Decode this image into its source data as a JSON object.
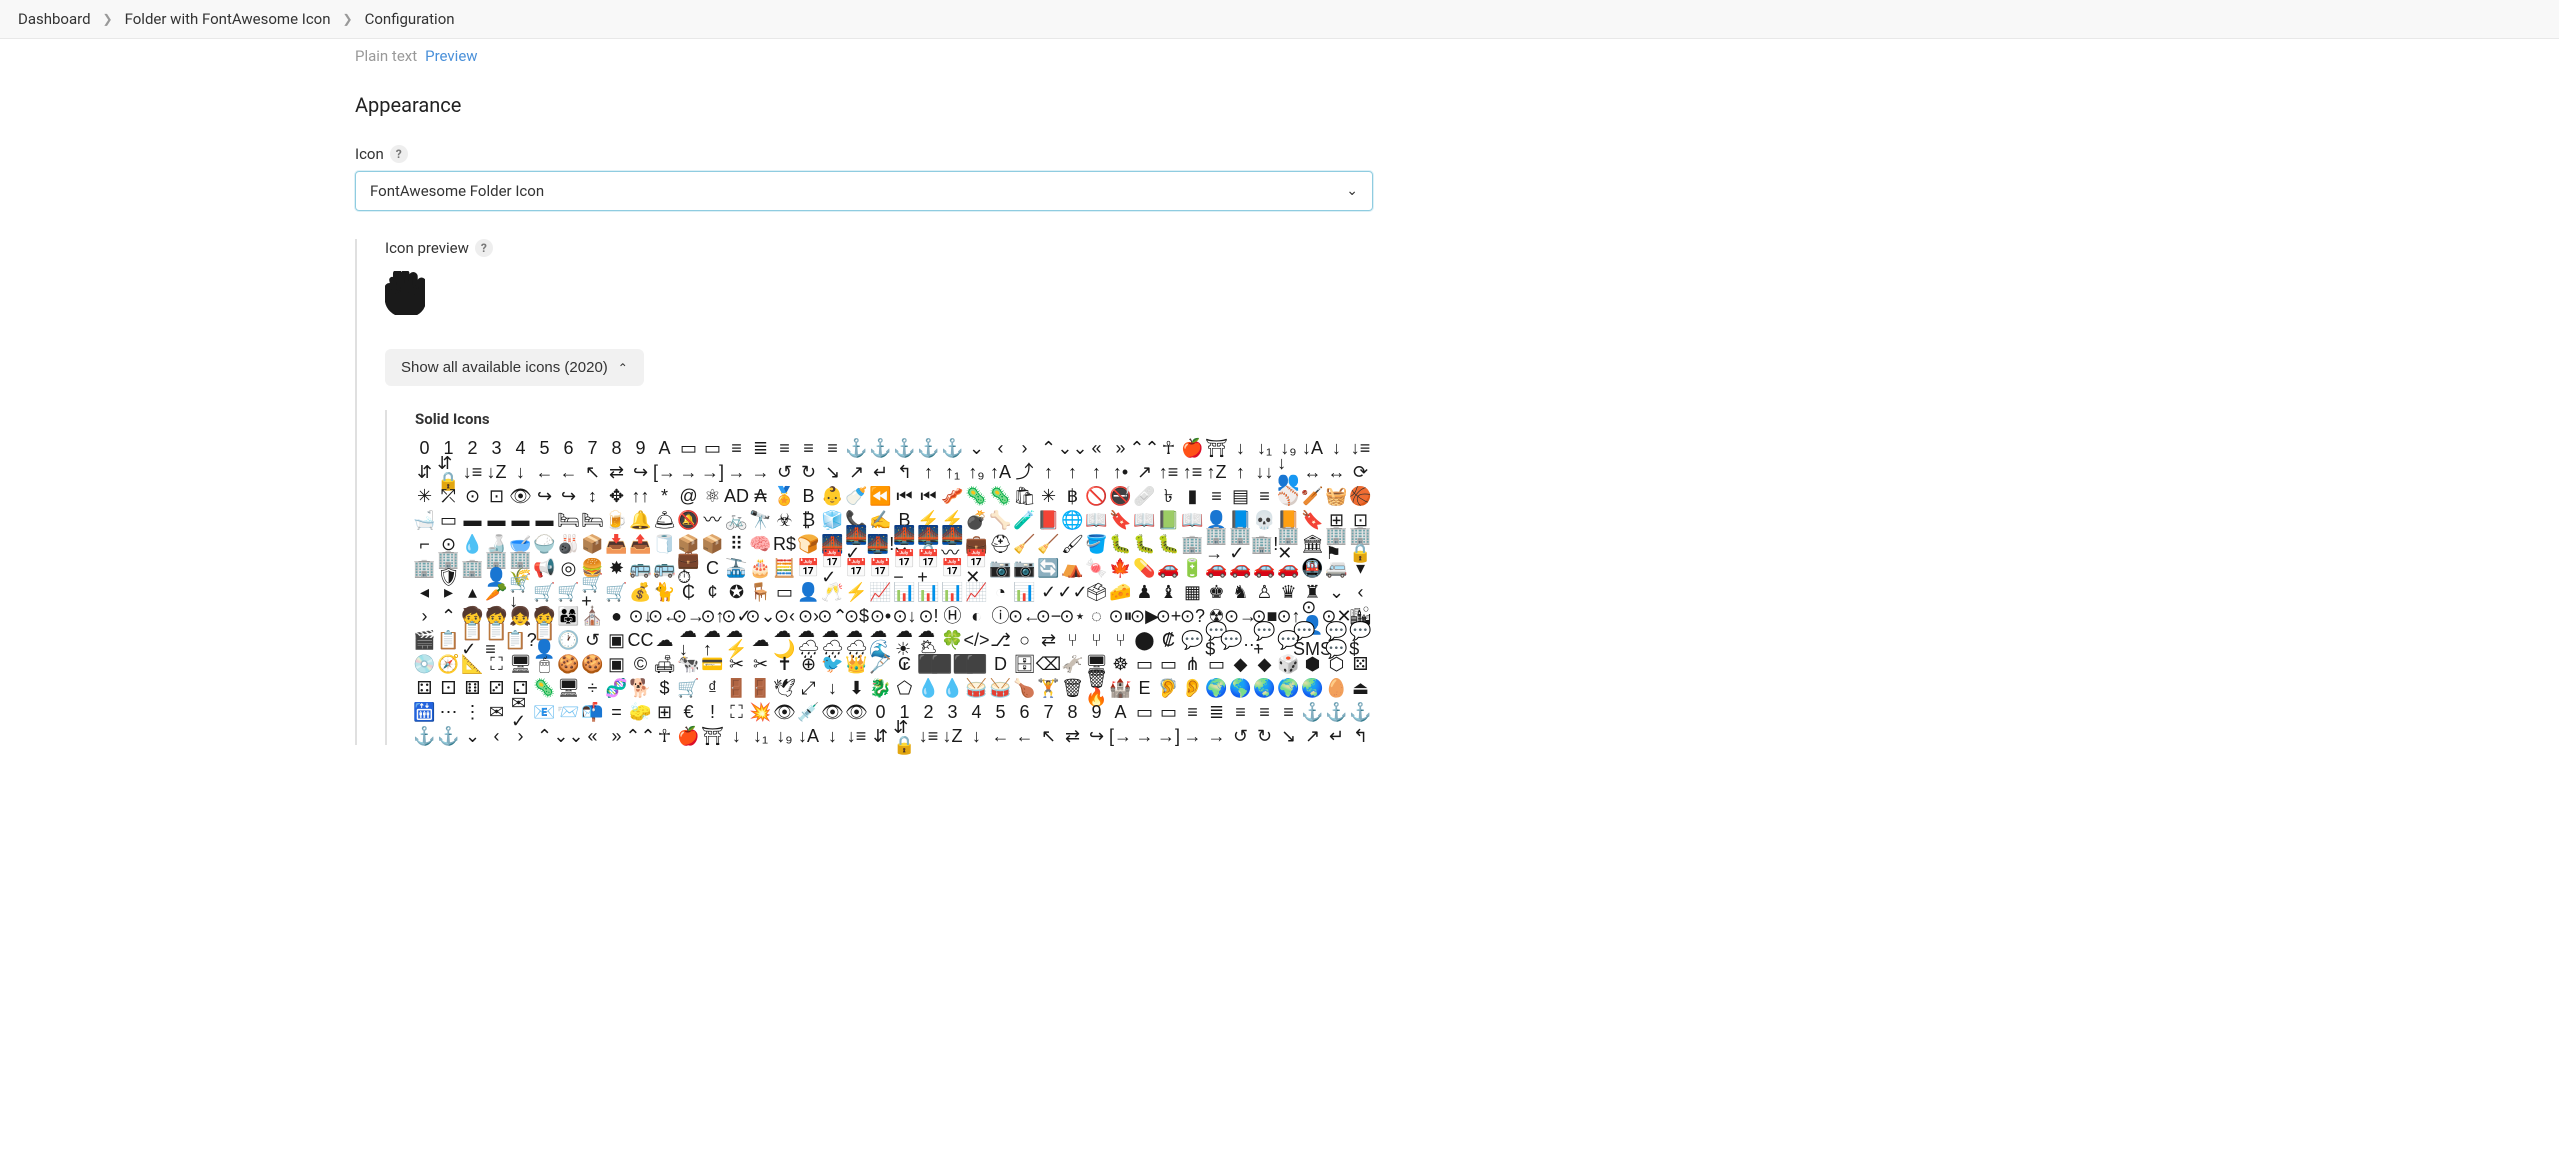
{
  "breadcrumb": {
    "items": [
      "Dashboard",
      "Folder with FontAwesome Icon",
      "Configuration"
    ]
  },
  "tabs": {
    "plain_text": "Plain text",
    "preview": "Preview"
  },
  "section": {
    "appearance_heading": "Appearance",
    "icon_label": "Icon",
    "help_glyph": "?",
    "icon_select_value": "FontAwesome Folder Icon",
    "icon_preview_label": "Icon preview",
    "expand_label": "Show all available icons (2020)",
    "solid_icons_heading": "Solid Icons"
  },
  "icon_grid": {
    "category": "Solid Icons",
    "total_shown_approx": 520,
    "sample_names": [
      "0",
      "1",
      "2",
      "3",
      "4",
      "5",
      "6",
      "7",
      "8",
      "9",
      "A",
      "address-card",
      "address-book",
      "align-center",
      "align-justify",
      "align-left",
      "align-right",
      "anchor",
      "anchor-circle-check",
      "anchor-circle-exclamation",
      "anchor-circle-xmark",
      "anchor-lock",
      "angle-down",
      "angle-left",
      "angle-right",
      "angle-up",
      "angles-down",
      "angles-left",
      "angles-right",
      "angles-up",
      "ankh",
      "apple-whole",
      "archway",
      "arrow-down",
      "arrow-down-1-9",
      "arrow-down-9-1",
      "arrow-down-a-z",
      "arrow-down-long",
      "arrow-down-short-wide",
      "arrow-down-up-across-line",
      "arrow-down-up-lock",
      "arrow-down-wide-short",
      "arrow-down-z-a",
      "arrow-left",
      "arrow-left-long",
      "arrow-pointer",
      "arrow-right",
      "arrow-right-arrow-left",
      "arrow-right-from-bracket",
      "arrow-right-long",
      "arrow-right-to-bracket",
      "arrow-right-to-city",
      "arrow-rotate-left",
      "arrow-rotate-right",
      "arrow-trend-down",
      "arrow-trend-up",
      "arrow-turn-down",
      "arrow-turn-up",
      "arrow-up",
      "arrow-up-1-9",
      "arrow-up-9-1",
      "arrow-up-a-z",
      "arrow-up-from-bracket",
      "arrow-up-from-ground-water",
      "arrow-up-from-water-pump",
      "arrow-up-long",
      "arrow-up-right-dots",
      "arrow-up-right-from-square",
      "arrow-up-short-wide",
      "arrow-up-wide-short",
      "arrow-up-z-a",
      "arrows-down-to-line",
      "arrows-down-to-people",
      "arrows-left-right",
      "arrows-left-right-to-line",
      "arrows-rotate",
      "arrows-spin",
      "arrows-split-up-and-left",
      "arrows-to-circle",
      "arrows-to-dot",
      "arrows-to-eye",
      "arrows-turn-right",
      "arrows-turn-to-dots",
      "arrows-up-down",
      "arrows-up-down-left-right",
      "arrows-up-to-line",
      "asterisk",
      "at",
      "atom",
      "audio-description",
      "austral-sign",
      "award",
      "b",
      "baby",
      "baby-carriage",
      "backward",
      "backward-fast",
      "backward-step",
      "bacon",
      "bacteria",
      "bacterium",
      "bag-shopping",
      "bahai",
      "baht-sign",
      "ban",
      "ban-smoking",
      "bandage",
      "bangladeshi-taka-sign",
      "barcode",
      "bars",
      "bars-progress",
      "bars-staggered",
      "baseball",
      "baseball-bat-ball",
      "basket-shopping",
      "basketball",
      "bath",
      "battery-empty",
      "battery-full",
      "battery-half",
      "battery-quarter",
      "battery-three-quarters",
      "bed",
      "bed-pulse",
      "beer-mug-empty",
      "bell",
      "bell-concierge",
      "bell-slash",
      "bezier-curve",
      "bicycle",
      "binoculars",
      "biohazard",
      "bitcoin-sign",
      "blender",
      "blender-phone",
      "blog",
      "bold",
      "bolt",
      "bolt-lightning",
      "bomb",
      "bone",
      "bong",
      "book",
      "book-atlas",
      "book-bible",
      "book-bookmark",
      "book-journal-whills",
      "book-medical",
      "book-open",
      "book-open-reader",
      "book-quran",
      "book-skull",
      "book-tanakh",
      "bookmark",
      "border-all",
      "border-none",
      "border-top-left",
      "bore-hole",
      "bottle-droplet",
      "bottle-water",
      "bowl-food",
      "bowl-rice",
      "bowling-ball",
      "box",
      "box-archive",
      "box-open",
      "box-tissue",
      "boxes-packing",
      "boxes-stacked",
      "braille",
      "brain",
      "brazilian-real-sign",
      "bread-slice",
      "bridge",
      "bridge-circle-check",
      "bridge-circle-exclamation",
      "bridge-circle-xmark",
      "bridge-lock",
      "bridge-water",
      "briefcase",
      "briefcase-medical",
      "broom",
      "broom-ball",
      "brush",
      "bucket",
      "bug",
      "bug-slash",
      "bugs",
      "building",
      "building-circle-arrow-right",
      "building-circle-check",
      "building-circle-exclamation",
      "building-circle-xmark",
      "building-columns",
      "building-flag",
      "building-lock",
      "building-ngo",
      "building-shield",
      "building-un",
      "building-user",
      "building-wheat",
      "bullhorn",
      "bullseye",
      "burger",
      "burst",
      "bus",
      "bus-simple",
      "business-time",
      "c",
      "cable-car",
      "cake-candles",
      "calculator",
      "calendar",
      "calendar-check",
      "calendar-day",
      "calendar-days",
      "calendar-minus",
      "calendar-plus",
      "calendar-week",
      "calendar-xmark",
      "camera",
      "camera-retro",
      "camera-rotate",
      "campground",
      "candy-cane",
      "cannabis",
      "capsules",
      "car",
      "car-battery",
      "car-burst",
      "car-on",
      "car-rear",
      "car-side",
      "car-tunnel",
      "caravan",
      "caret-down",
      "caret-left",
      "caret-right",
      "caret-up",
      "carrot",
      "cart-arrow-down",
      "cart-flatbed",
      "cart-flatbed-suitcase",
      "cart-plus",
      "cart-shopping",
      "cash-register",
      "cat",
      "cedi-sign",
      "cent-sign",
      "certificate",
      "chair",
      "chalkboard",
      "chalkboard-user",
      "champagne-glasses",
      "charging-station",
      "chart-area",
      "chart-bar",
      "chart-column",
      "chart-gantt",
      "chart-line",
      "chart-pie",
      "chart-simple",
      "check",
      "check-double",
      "check-to-slot",
      "cheese",
      "chess",
      "chess-bishop",
      "chess-board",
      "chess-king",
      "chess-knight",
      "chess-pawn",
      "chess-queen",
      "chess-rook",
      "chevron-down",
      "chevron-left",
      "chevron-right",
      "chevron-up",
      "child",
      "child-combatant",
      "child-dress",
      "child-reaching",
      "children",
      "church",
      "circle",
      "circle-arrow-down",
      "circle-arrow-left",
      "circle-arrow-right",
      "circle-arrow-up",
      "circle-check",
      "circle-chevron-down",
      "circle-chevron-left",
      "circle-chevron-right",
      "circle-chevron-up",
      "circle-dollar-to-slot",
      "circle-dot",
      "circle-down",
      "circle-exclamation",
      "circle-h",
      "circle-half-stroke",
      "circle-info",
      "circle-left",
      "circle-minus",
      "circle-nodes",
      "circle-notch",
      "circle-pause",
      "circle-play",
      "circle-plus",
      "circle-question",
      "circle-radiation",
      "circle-right",
      "circle-stop",
      "circle-up",
      "circle-user",
      "circle-xmark",
      "city",
      "clapperboard",
      "clipboard",
      "clipboard-check",
      "clipboard-list",
      "clipboard-question",
      "clipboard-user",
      "clock",
      "clock-rotate-left",
      "clone",
      "closed-captioning",
      "cloud",
      "cloud-arrow-down",
      "cloud-arrow-up",
      "cloud-bolt",
      "cloud-meatball",
      "cloud-moon",
      "cloud-moon-rain",
      "cloud-rain",
      "cloud-showers-heavy",
      "cloud-showers-water",
      "cloud-sun",
      "cloud-sun-rain",
      "clover",
      "code",
      "code-branch",
      "code-commit",
      "code-compare",
      "code-fork",
      "code-merge",
      "code-pull-request",
      "coins",
      "colon-sign",
      "comment",
      "comment-dollar",
      "comment-dots",
      "comment-medical",
      "comment-slash",
      "comment-sms",
      "comments",
      "comments-dollar",
      "compact-disc",
      "compass",
      "compass-drafting",
      "compress",
      "computer",
      "computer-mouse",
      "cookie",
      "cookie-bite",
      "copy",
      "copyright",
      "couch",
      "cow",
      "credit-card",
      "crop",
      "crop-simple",
      "cross",
      "crosshairs",
      "crow",
      "crown",
      "crutch",
      "cruzeiro-sign",
      "cube",
      "cubes",
      "cubes-stacked",
      "d",
      "database",
      "delete-left",
      "democrat",
      "desktop",
      "dharmachakra",
      "diagram-next",
      "diagram-predecessor",
      "diagram-project",
      "diagram-successor",
      "diamond",
      "diamond-turn-right",
      "dice",
      "dice-d20",
      "dice-d6",
      "dice-five",
      "dice-four",
      "dice-one",
      "dice-six",
      "dice-three",
      "dice-two",
      "disease",
      "display",
      "divide",
      "dna",
      "dog",
      "dollar-sign",
      "dolly",
      "dong-sign",
      "door-closed",
      "door-open",
      "dove",
      "down-left-and-up-right-to-center",
      "down-long",
      "download",
      "dragon",
      "draw-polygon",
      "droplet",
      "droplet-slash",
      "drum",
      "drum-steelpan",
      "drumstick-bite",
      "dumbbell",
      "dumpster",
      "dumpster-fire",
      "dungeon",
      "e",
      "ear-deaf",
      "ear-listen",
      "earth-africa",
      "earth-americas",
      "earth-asia",
      "earth-europe",
      "earth-oceania",
      "egg",
      "eject",
      "elevator",
      "ellipsis",
      "ellipsis-vertical",
      "envelope",
      "envelope-circle-check",
      "envelope-open",
      "envelope-open-text",
      "envelopes-bulk",
      "equals",
      "eraser",
      "ethernet",
      "euro-sign",
      "exclamation",
      "expand",
      "explosion",
      "eye",
      "eye-dropper",
      "eye-low-vision",
      "eye-slash"
    ]
  }
}
